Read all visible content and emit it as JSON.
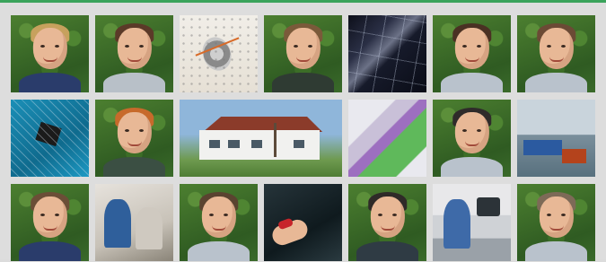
{
  "gallery": {
    "accent_color": "#3aa35b",
    "tiles": [
      {
        "kind": "portrait",
        "hair": "#c7a15d",
        "shirt": "#2a3c6b"
      },
      {
        "kind": "portrait",
        "hair": "#5b3a28",
        "shirt": "#b8c0c8"
      },
      {
        "kind": "photo",
        "icon": "chart-document-icon"
      },
      {
        "kind": "portrait",
        "hair": "#7a5a3a",
        "shirt": "#2f3b33"
      },
      {
        "kind": "photo",
        "icon": "solar-panel-icon"
      },
      {
        "kind": "portrait",
        "hair": "#4a3123",
        "shirt": "#b9c2cc"
      },
      {
        "kind": "portrait",
        "hair": "#6b4a35",
        "shirt": "#b9c2cc"
      },
      {
        "kind": "photo",
        "icon": "circuit-board-icon"
      },
      {
        "kind": "portrait",
        "hair": "#c76a2b",
        "shirt": "#3b4f43"
      },
      {
        "kind": "photo",
        "icon": "building-icon",
        "wide": true
      },
      {
        "kind": "photo",
        "icon": "led-strips-icon"
      },
      {
        "kind": "portrait",
        "hair": "#2f2b2a",
        "shirt": "#b9c2cc"
      },
      {
        "kind": "photo",
        "icon": "workshop-icon"
      },
      {
        "kind": "portrait",
        "hair": "#6b4e37",
        "shirt": "#2a3c6b"
      },
      {
        "kind": "photo",
        "icon": "repair-team-icon"
      },
      {
        "kind": "portrait",
        "hair": "#5a4330",
        "shirt": "#b9c2cc"
      },
      {
        "kind": "photo",
        "icon": "hands-components-icon"
      },
      {
        "kind": "portrait",
        "hair": "#2f2a28",
        "shirt": "#2f3b44"
      },
      {
        "kind": "photo",
        "icon": "electronics-bench-icon"
      },
      {
        "kind": "portrait",
        "hair": "#7d6a57",
        "shirt": "#b9c2cc"
      }
    ]
  }
}
